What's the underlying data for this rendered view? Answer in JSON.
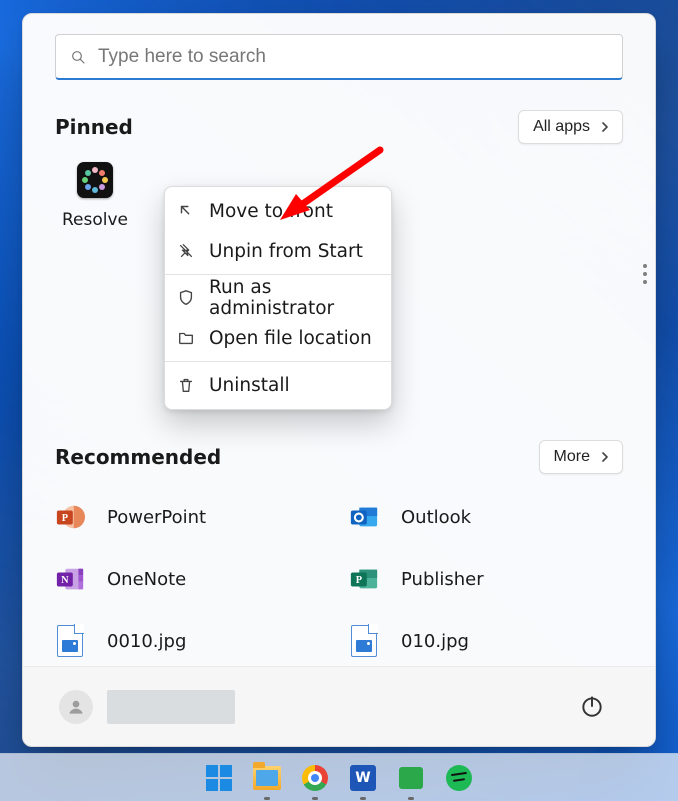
{
  "search": {
    "placeholder": "Type here to search"
  },
  "pinned": {
    "title": "Pinned",
    "allapps_label": "All apps",
    "apps": [
      {
        "name": "Resolve"
      }
    ]
  },
  "context_menu": {
    "move_to_front": "Move to front",
    "unpin": "Unpin from Start",
    "run_as_admin": "Run as administrator",
    "open_file_location": "Open file location",
    "uninstall": "Uninstall"
  },
  "recommended": {
    "title": "Recommended",
    "more_label": "More",
    "items": [
      {
        "label": "PowerPoint",
        "icon": "powerpoint"
      },
      {
        "label": "Outlook",
        "icon": "outlook"
      },
      {
        "label": "OneNote",
        "icon": "onenote"
      },
      {
        "label": "Publisher",
        "icon": "publisher"
      },
      {
        "label": "0010.jpg",
        "icon": "image-file"
      },
      {
        "label": "010.jpg",
        "icon": "image-file"
      }
    ]
  },
  "taskbar": {
    "start": "Start",
    "explorer": "File Explorer",
    "chrome": "Google Chrome",
    "word": "Word",
    "messages": "Messages",
    "spotify": "Spotify"
  }
}
